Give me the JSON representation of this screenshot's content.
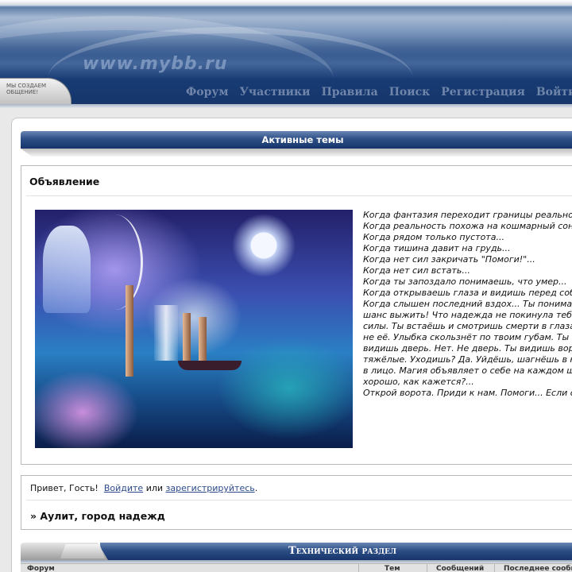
{
  "header": {
    "logo_url": "www.mybb.ru",
    "badge_text": "мы создаем общение!",
    "nav": [
      "Форум",
      "Участники",
      "Правила",
      "Поиск",
      "Регистрация",
      "Войти"
    ]
  },
  "active_topics": {
    "label": "Активные темы"
  },
  "announcement": {
    "title": "Объявление",
    "image_alt": "fantasy-artwork",
    "lines": [
      "Когда фантазия переходит границы реально",
      "Когда реальность похожа на кошмарный сон",
      "Когда рядом только пустота...",
      "Когда тишина давит на грудь...",
      "Когда нет сил закричать \"Помоги!\"...",
      "Когда нет сил встать...",
      "Когда ты запоздало понимаешь, что умер...",
      "Когда открываешь глаза и видишь перед соб",
      "Когда слышен последний вздох... Ты понимае",
      "шанс выжить! Что надежда не покинула тебя",
      "силы. Ты встаёшь и смотришь смерти в глаза",
      "не её. Улыбка скользнёт по твоим губам. Ты з",
      "видишь дверь. Нет. Не дверь. Ты видишь вор",
      "тяжёлые. Уходишь? Да. Уйдёшь, шагнёшь в н",
      "в лицо. Магия объявляет о себе на каждом ш",
      "хорошо, как кажется?...",
      "Открой ворота. Приди к нам. Помоги... Если с"
    ]
  },
  "greeting": {
    "hello": "Привет, Гость!",
    "login_link": "Войдите",
    "or": "или",
    "register_link": "зарегистрируйтесь",
    "period": ".",
    "forum_name": "» Аулит, город надежд"
  },
  "category": {
    "title": "Технический раздел",
    "columns": [
      "Форум",
      "Тем",
      "Сообщений",
      "Последнее сообщ"
    ]
  }
}
